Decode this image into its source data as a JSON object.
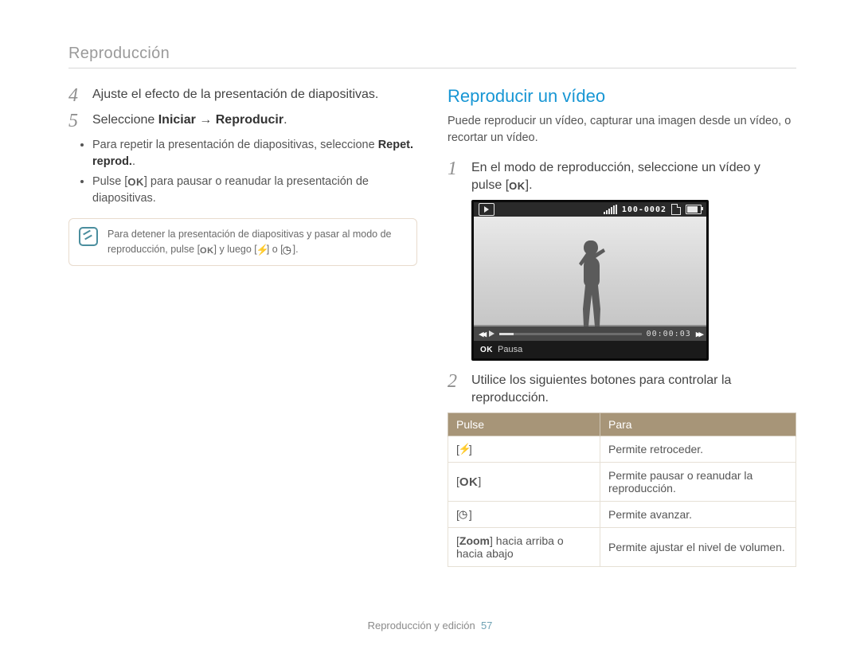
{
  "header": {
    "breadcrumb": "Reproducción"
  },
  "left": {
    "steps": {
      "four": {
        "num": "4",
        "text": "Ajuste el efecto de la presentación de diapositivas."
      },
      "five": {
        "num": "5",
        "prefix": "Seleccione ",
        "bold1": "Iniciar",
        "arrow": " → ",
        "bold2": "Reproducir",
        "suffix": "."
      }
    },
    "bullets": {
      "b1_pre": "Para repetir la presentación de diapositivas, seleccione ",
      "b1_bold": "Repet. reprod.",
      "b1_post": ".",
      "b2_pre": "Pulse [",
      "b2_ok": "OK",
      "b2_post": "] para pausar o reanudar la presentación de diapositivas."
    },
    "note": {
      "l1": "Para detener la presentación de diapositivas y pasar al modo de",
      "l2_a": "reproducción, pulse [",
      "l2_ok": "OK",
      "l2_b": "] y luego [",
      "l2_c": "] o [",
      "l2_d": "]."
    }
  },
  "right": {
    "title": "Reproducir un vídeo",
    "intro": "Puede reproducir un vídeo, capturar una imagen desde un vídeo, o recortar un vídeo.",
    "steps": {
      "one": {
        "num": "1",
        "l1": "En el modo de reproducción, seleccione un vídeo y",
        "l2_a": "pulse [",
        "l2_ok": "OK",
        "l2_b": "]."
      },
      "two": {
        "num": "2",
        "l1": "Utilice los siguientes botones para controlar la",
        "l2": "reproducción."
      }
    },
    "lcd": {
      "counter": "100-0002",
      "timecode": "00:00:03",
      "ok": "OK",
      "pausa": "Pausa"
    },
    "table": {
      "h1": "Pulse",
      "h2": "Para",
      "rows": {
        "r1": {
          "c2": "Permite retroceder."
        },
        "r2": {
          "c1": "OK",
          "c2": "Permite pausar o reanudar la reproducción."
        },
        "r3": {
          "c2": "Permite avanzar."
        },
        "r4": {
          "c1_a": "[",
          "c1_bold": "Zoom",
          "c1_b": "] hacia arriba o hacia abajo",
          "c2": "Permite ajustar el nivel de volumen."
        }
      }
    }
  },
  "footer": {
    "label": "Reproducción y edición",
    "page": "57"
  }
}
